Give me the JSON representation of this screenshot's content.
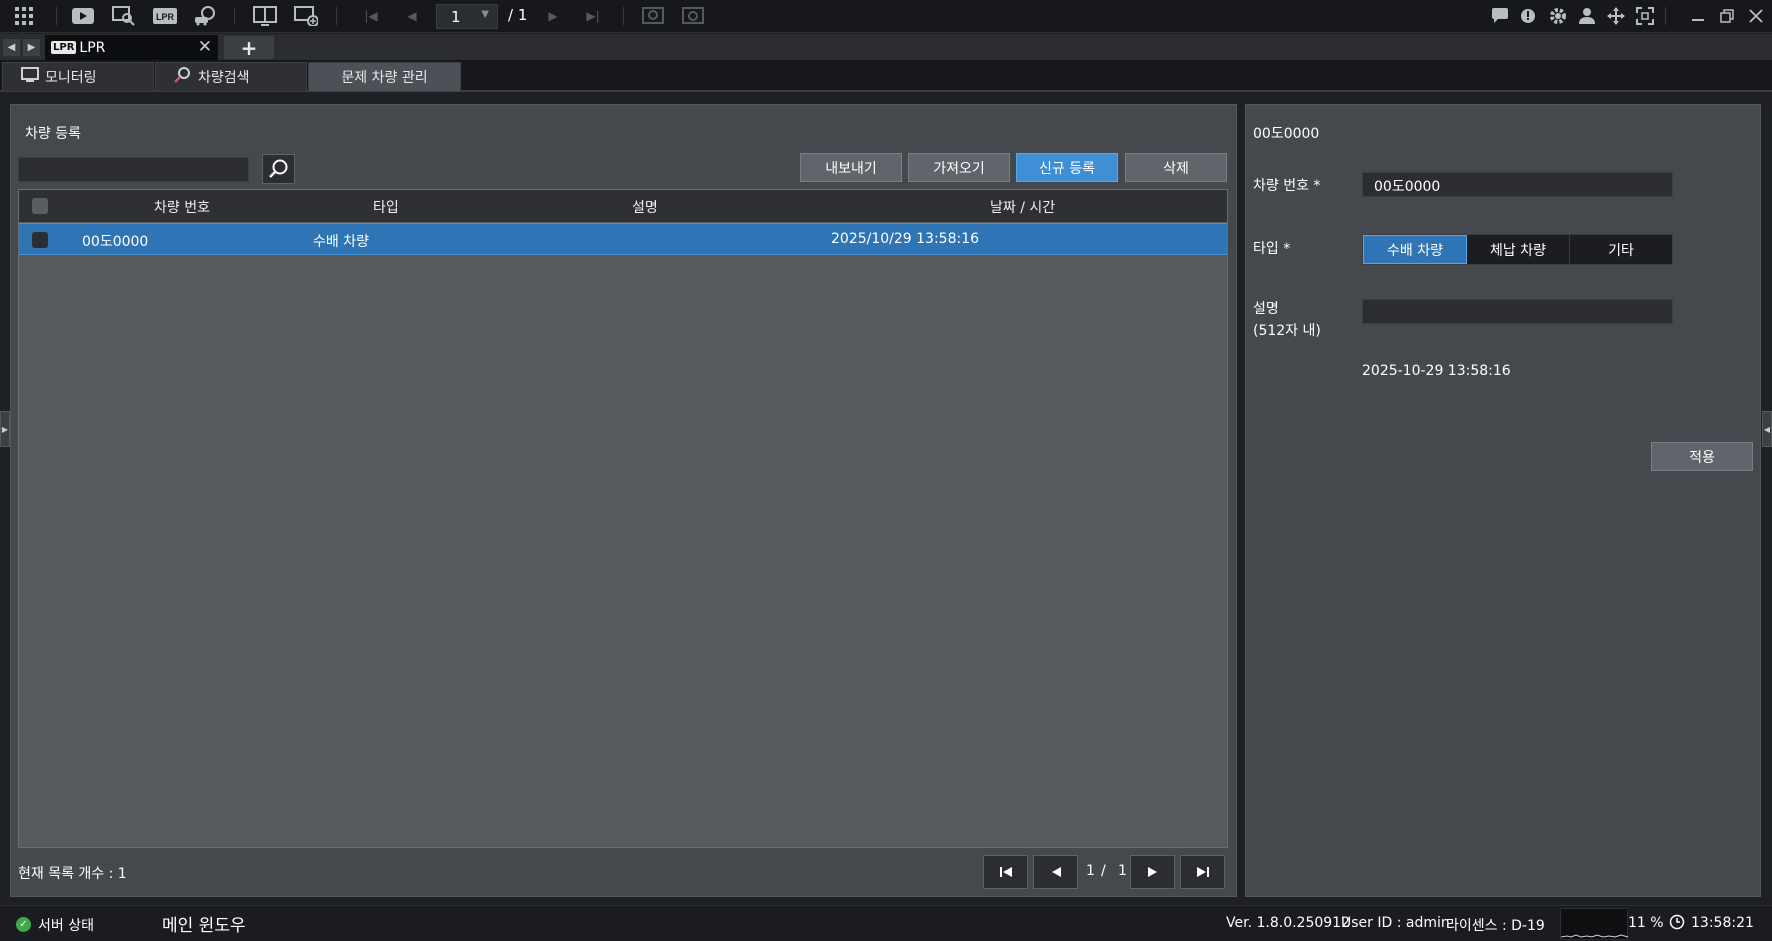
{
  "toolbar": {
    "page_current": "1",
    "page_total": "/ 1"
  },
  "doc_tab": {
    "badge": "LPR",
    "title": "LPR",
    "close": "✕",
    "add": "+"
  },
  "subtabs": [
    {
      "label": "모니터링",
      "icon": "monitor-icon"
    },
    {
      "label": "차량검색",
      "icon": "search-car-icon"
    },
    {
      "label": "문제 차량 관리",
      "active": true
    }
  ],
  "left": {
    "title": "차량 등록",
    "search_placeholder": "",
    "buttons": {
      "export": "내보내기",
      "import": "가져오기",
      "new": "신규 등록",
      "delete": "삭제"
    },
    "columns": [
      "차량 번호",
      "타입",
      "설명",
      "날짜 / 시간"
    ],
    "rows": [
      {
        "plate": "00도0000",
        "type": "수배 차량",
        "desc": "",
        "datetime": "2025/10/29 13:58:16",
        "selected": true
      }
    ],
    "count_label": "현재 목록 개수 : 1",
    "pager": {
      "current": "1",
      "sep": "/",
      "total": "1"
    }
  },
  "right": {
    "header": "00도0000",
    "plate_label": "차량 번호 *",
    "plate_value": "00도0000",
    "type_label": "타입 *",
    "type_options": [
      "수배 차량",
      "체납 차량",
      "기타"
    ],
    "type_selected": "수배 차량",
    "desc_label": "설명",
    "desc_hint": "(512자 내)",
    "desc_value": "",
    "timestamp": "2025-10-29 13:58:16",
    "apply": "적용"
  },
  "status": {
    "server": "서버 상태",
    "window": "메인 윈도우",
    "version": "Ver. 1.8.0.250912",
    "user": "User ID : admin",
    "license": "라이센스 : D-19",
    "cpu": "11 %",
    "time": "13:58:21"
  },
  "colors": {
    "accent": "#3f8fd6",
    "selection": "#2f75b5",
    "panel": "#45484d",
    "ok": "#3ea84a"
  }
}
